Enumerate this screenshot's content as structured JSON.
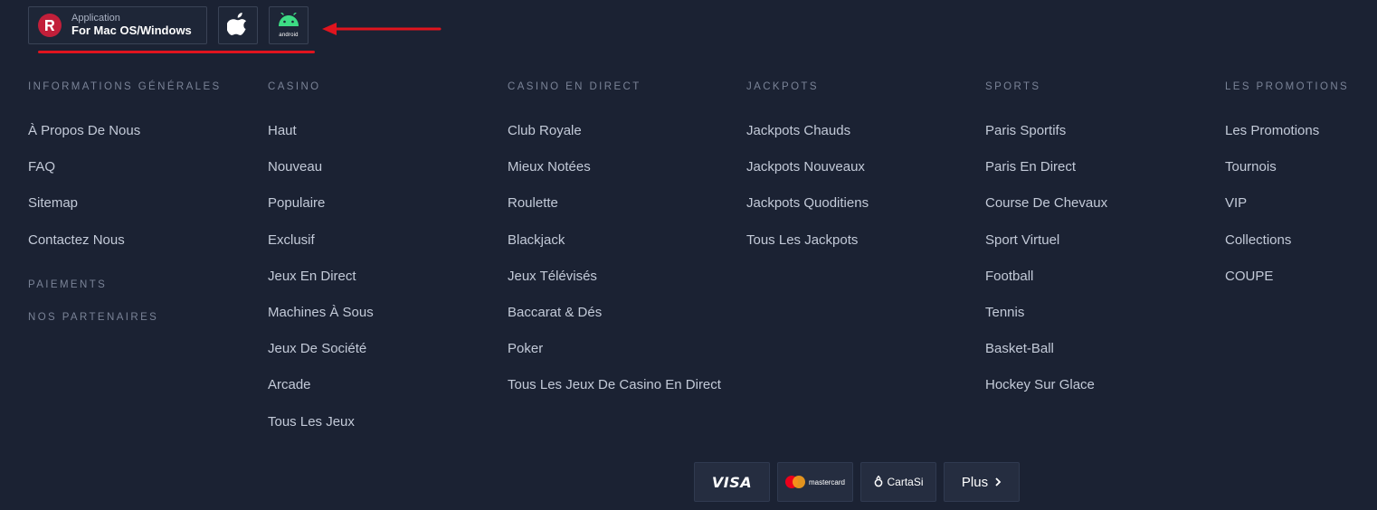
{
  "app": {
    "line1": "Application",
    "line2": "For Mac OS/Windows",
    "apple_icon": "apple-icon",
    "android_icon": "android-icon",
    "android_label": "android",
    "annotation_color": "#e0141e"
  },
  "columns": [
    {
      "title": "INFORMATIONS GÉNÉRALES",
      "items": [
        "À Propos De Nous",
        "FAQ",
        "Sitemap",
        "Contactez Nous"
      ]
    },
    {
      "title": "CASINO",
      "items": [
        "Haut",
        "Nouveau",
        "Populaire",
        "Exclusif",
        "Jeux En Direct",
        "Machines À Sous",
        "Jeux De Société",
        "Arcade",
        "Tous Les Jeux"
      ]
    },
    {
      "title": "CASINO EN DIRECT",
      "items": [
        "Club Royale",
        "Mieux Notées",
        "Roulette",
        "Blackjack",
        "Jeux Télévisés",
        "Baccarat & Dés",
        "Poker",
        "Tous Les Jeux De Casino En Direct"
      ]
    },
    {
      "title": "JACKPOTS",
      "items": [
        "Jackpots Chauds",
        "Jackpots Nouveaux",
        "Jackpots Quoditiens",
        "Tous Les Jackpots"
      ]
    },
    {
      "title": "SPORTS",
      "items": [
        "Paris Sportifs",
        "Paris En Direct",
        "Course De Chevaux",
        "Sport Virtuel",
        "Football",
        "Tennis",
        "Basket-Ball",
        "Hockey Sur Glace"
      ]
    },
    {
      "title": "LES PROMOTIONS",
      "items": [
        "Les Promotions",
        "Tournois",
        "VIP",
        "Collections",
        "COUPE"
      ]
    }
  ],
  "extra_links": {
    "payments": "PAIEMENTS",
    "partners": "NOS PARTENAIRES"
  },
  "payments": {
    "visa": "VISA",
    "mastercard": "mastercard",
    "cartasi": "CartaSi",
    "more": "Plus"
  },
  "colors": {
    "background": "#1b2233",
    "brand_red": "#c21f3a",
    "android_green": "#3ddc84"
  }
}
